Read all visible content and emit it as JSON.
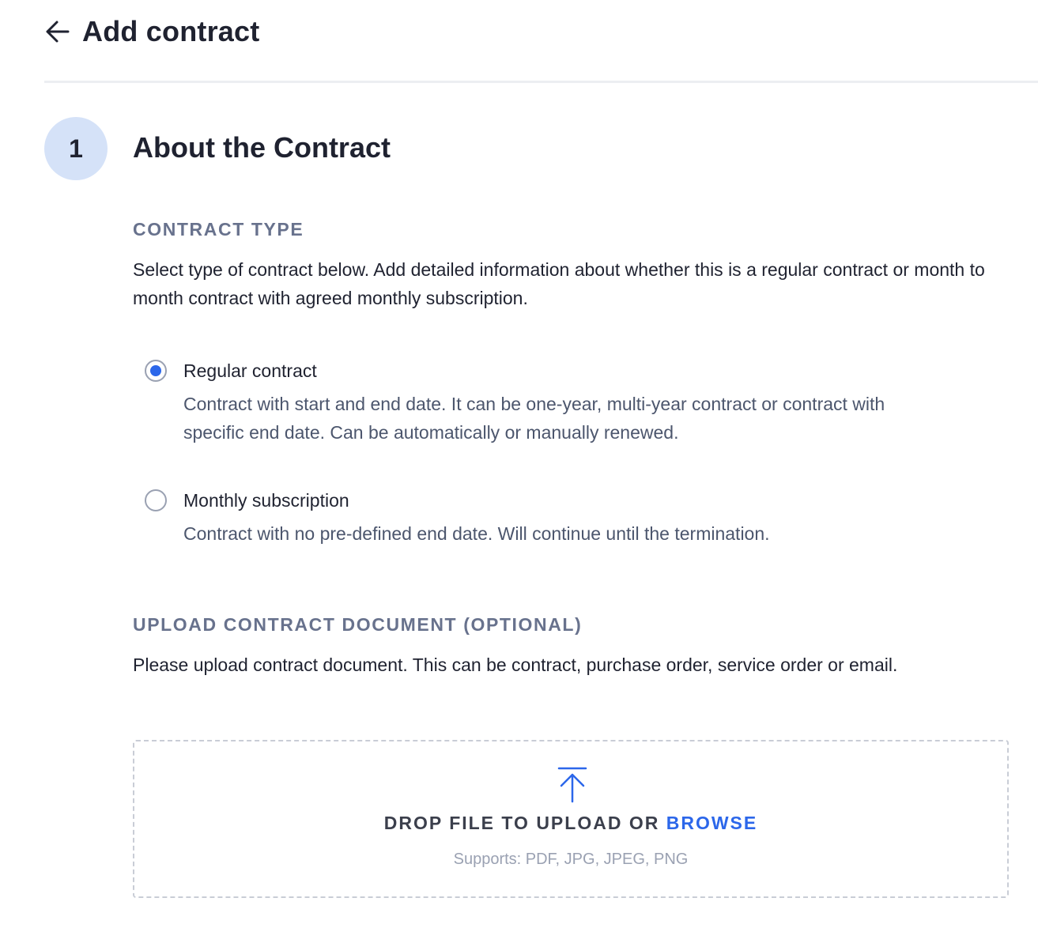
{
  "header": {
    "title": "Add contract",
    "back_icon": "arrow-left-icon"
  },
  "step": {
    "number": "1",
    "title": "About the Contract"
  },
  "contract_type": {
    "label": "CONTRACT TYPE",
    "description": "Select type of contract below. Add detailed information about whether this is a regular contract or month to month contract with agreed monthly subscription.",
    "options": [
      {
        "label": "Regular contract",
        "description": "Contract with start and end date. It can be one-year, multi-year contract or contract with specific end date. Can be automatically or manually renewed.",
        "selected": true
      },
      {
        "label": "Monthly subscription",
        "description": "Contract with no pre-defined end date. Will continue until the termination.",
        "selected": false
      }
    ]
  },
  "upload": {
    "label": "UPLOAD CONTRACT DOCUMENT (OPTIONAL)",
    "description": "Please upload contract document. This can be contract, purchase order, service order or email.",
    "drop_text": "DROP FILE TO UPLOAD OR",
    "browse_label": "BROWSE",
    "supports": "Supports: PDF, JPG, JPEG, PNG",
    "icon": "upload-arrow-icon"
  },
  "colors": {
    "accent": "#2c67ea",
    "step_circle": "#d5e2f8",
    "section_label": "#68728d",
    "muted_text": "#4c566d"
  }
}
